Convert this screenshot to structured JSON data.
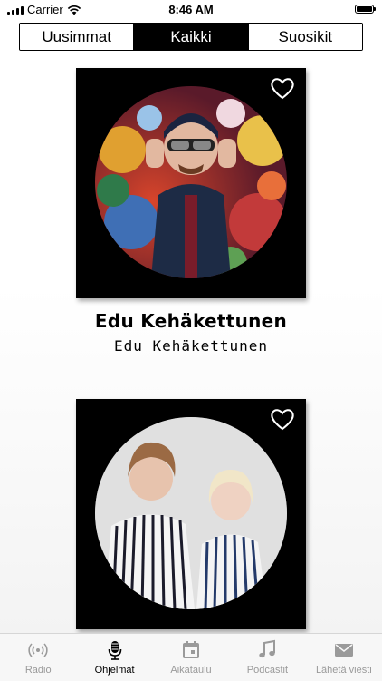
{
  "status_bar": {
    "carrier": "Carrier",
    "time": "8:46 AM"
  },
  "segments": [
    {
      "label": "Uusimmat",
      "active": false
    },
    {
      "label": "Kaikki",
      "active": true
    },
    {
      "label": "Suosikit",
      "active": false
    }
  ],
  "shows": [
    {
      "title": "Edu Kehäkettunen",
      "subtitle": "Edu Kehäkettunen"
    },
    {
      "title": "",
      "subtitle": ""
    }
  ],
  "tabbar": {
    "items": [
      {
        "label": "Radio",
        "icon": "radio-waves-icon",
        "active": false
      },
      {
        "label": "Ohjelmat",
        "icon": "microphone-icon",
        "active": true
      },
      {
        "label": "Aikataulu",
        "icon": "calendar-icon",
        "active": false
      },
      {
        "label": "Podcastit",
        "icon": "music-note-icon",
        "active": false
      },
      {
        "label": "Lähetä viesti",
        "icon": "envelope-icon",
        "active": false
      }
    ]
  },
  "colors": {
    "accent": "#000000",
    "inactive_tab": "#9a9a9a",
    "tabbar_bg": "#f7f7f7"
  }
}
